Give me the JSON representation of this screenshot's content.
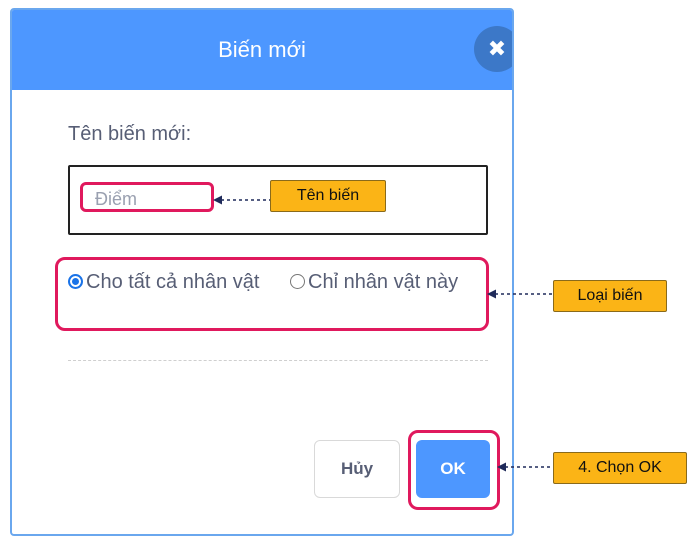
{
  "dialog": {
    "title": "Biến mới",
    "close_symbol": "✖",
    "field_label": "Tên biến mới:",
    "name_input": {
      "placeholder": "Điểm"
    },
    "scope_options": [
      {
        "label": "Cho tất cả nhân vật",
        "checked": true
      },
      {
        "label": "Chỉ nhân vật này",
        "checked": false
      }
    ],
    "cancel_label": "Hủy",
    "ok_label": "OK"
  },
  "annotations": {
    "name_callout": "Tên biến",
    "scope_callout": "Loại biến",
    "ok_callout": "4. Chọn OK"
  },
  "colors": {
    "header": "#4d97ff",
    "highlight": "#e0195d",
    "callout": "#fbb416"
  },
  "icons": [
    "close-icon",
    "radio-checked-icon",
    "radio-unchecked-icon",
    "arrow-left-icon"
  ]
}
